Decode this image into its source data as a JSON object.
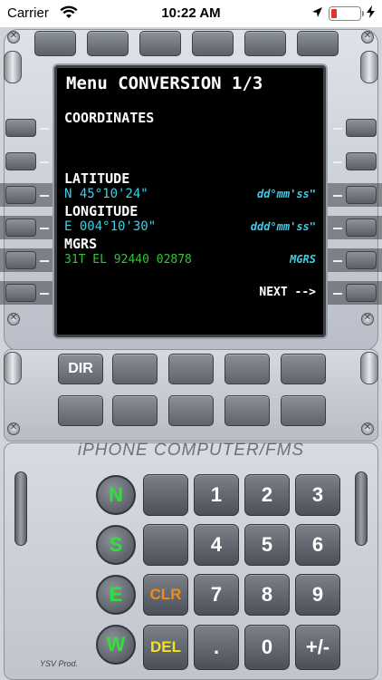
{
  "status_bar": {
    "carrier": "Carrier",
    "time": "10:22 AM",
    "battery_level": 0.2,
    "battery_color": "#e33333",
    "icons": [
      "wifi-icon",
      "location-arrow-icon",
      "battery-icon",
      "charging-bolt-icon"
    ]
  },
  "screen": {
    "title": "Menu CONVERSION 1/3",
    "section_label": "COORDINATES",
    "latitude_label": "LATITUDE",
    "latitude_value": "N 45°10'24\"",
    "latitude_format": "dd°mm'ss\"",
    "longitude_label": "LONGITUDE",
    "longitude_value": "E 004°10'30\"",
    "longitude_format": "ddd°mm'ss\"",
    "mgrs_label": "MGRS",
    "mgrs_value": "31T EL 92440 02878",
    "mgrs_format": "MGRS",
    "next_label": "NEXT -->"
  },
  "function_keys": {
    "dir_label": "DIR"
  },
  "brand": "iPHONE COMPUTER/FMS",
  "keypad": {
    "directions": [
      "N",
      "S",
      "E",
      "W"
    ],
    "clr_label": "CLR",
    "del_label": "DEL",
    "digits": [
      "1",
      "2",
      "3",
      "4",
      "5",
      "6",
      "7",
      "8",
      "9"
    ],
    "dot_label": ".",
    "zero_label": "0",
    "sign_label": "+/-"
  },
  "credit": "YSV Prod.",
  "colors": {
    "screen_white": "#ffffff",
    "screen_cyan": "#3fd0e6",
    "screen_green": "#33c23a",
    "direction_green": "#2ee03a",
    "clr_orange": "#f08a1e",
    "del_yellow": "#f4e21c"
  }
}
